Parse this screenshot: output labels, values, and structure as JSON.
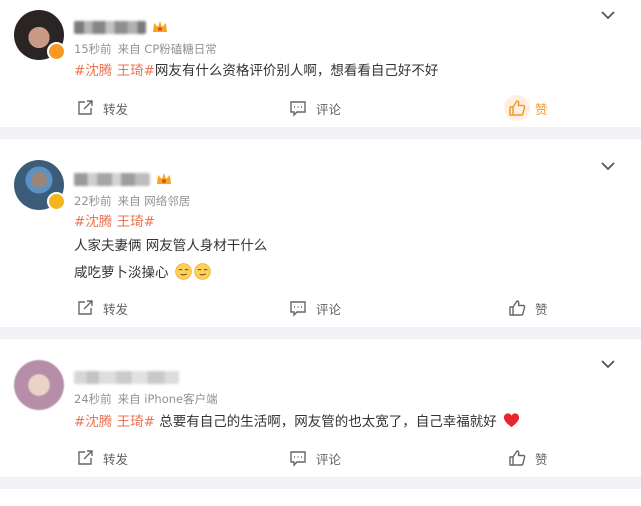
{
  "colors": {
    "topic": "#eb7350",
    "meta": "#939393",
    "action": "#636363",
    "liked": "#f39a2b",
    "background": "#f1f2f5"
  },
  "posts": [
    {
      "time": "15秒前",
      "source": "来自 CP粉磕糖日常",
      "topic_text": "#沈腾 王琦#",
      "text_lines": [
        "网友有什么资格评价别人啊，想看看自己好不好"
      ],
      "actions": {
        "repost": "转发",
        "comment": "评论",
        "like": "赞"
      },
      "liked": true
    },
    {
      "time": "22秒前",
      "source": "来自 网络邻居",
      "topic_text": "#沈腾 王琦#",
      "text_lines": [
        "人家夫妻俩 网友管人身材干什么",
        "咸吃萝卜淡操心"
      ],
      "emoji": [
        "smirk-emoji",
        "smirk-emoji"
      ],
      "actions": {
        "repost": "转发",
        "comment": "评论",
        "like": "赞"
      },
      "liked": false
    },
    {
      "time": "24秒前",
      "source": "来自 iPhone客户端",
      "topic_text": "#沈腾 王琦#",
      "text_lines": [
        " 总要有自己的生活啊，网友管的也太宽了，自己幸福就好"
      ],
      "emoji": [
        "red-heart-emoji"
      ],
      "actions": {
        "repost": "转发",
        "comment": "评论",
        "like": "赞"
      },
      "liked": false
    }
  ]
}
